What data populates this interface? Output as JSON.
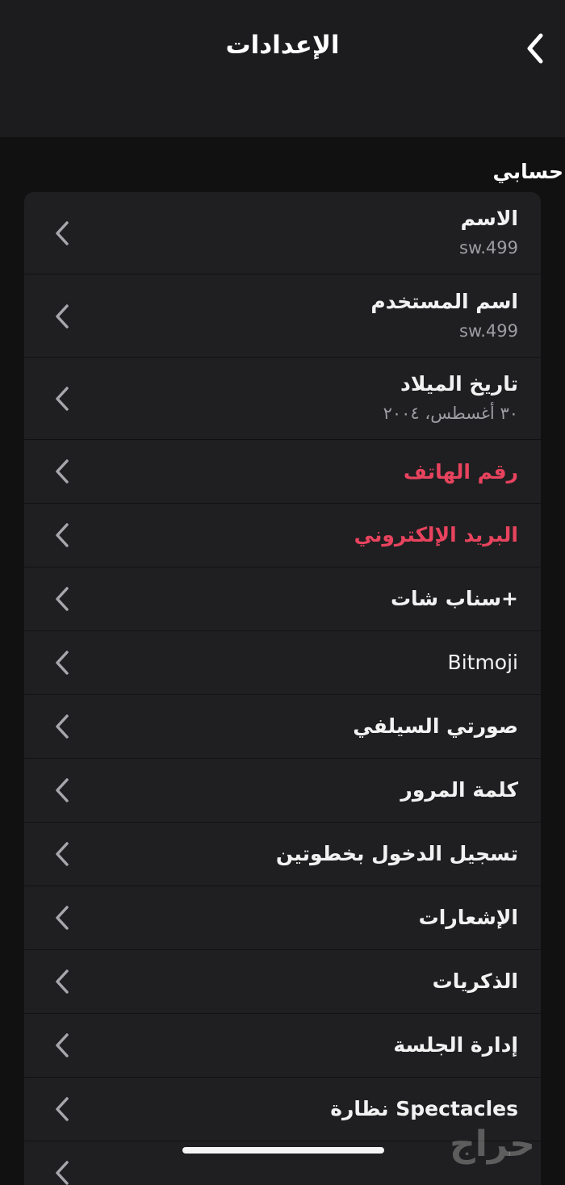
{
  "header": {
    "title": "الإعدادات"
  },
  "section": {
    "title": "حسابي"
  },
  "rows": [
    {
      "label": "الاسم",
      "sub": "sw.499"
    },
    {
      "label": "اسم المستخدم",
      "sub": "sw.499"
    },
    {
      "label": "تاريخ الميلاد",
      "sub": "٣٠ أغسطس، ٢٠٠٤"
    },
    {
      "label": "رقم الهاتف"
    },
    {
      "label": "البريد الإلكتروني"
    },
    {
      "label": "سناب شات+"
    },
    {
      "label": "Bitmoji"
    },
    {
      "label": "صورتي السيلفي"
    },
    {
      "label": "كلمة المرور"
    },
    {
      "label": "تسجيل الدخول بخطوتين"
    },
    {
      "label": "الإشعارات"
    },
    {
      "label": "الذكريات"
    },
    {
      "label": "إدارة الجلسة"
    },
    {
      "label": "نظارة Spectacles"
    }
  ],
  "watermark": {
    "text": "حراج"
  },
  "colors": {
    "background": "#111111",
    "header": "#1c1c1e",
    "card": "#1f1f21",
    "alert_red": "#e8435e",
    "secondary_text": "#9d9da2"
  }
}
